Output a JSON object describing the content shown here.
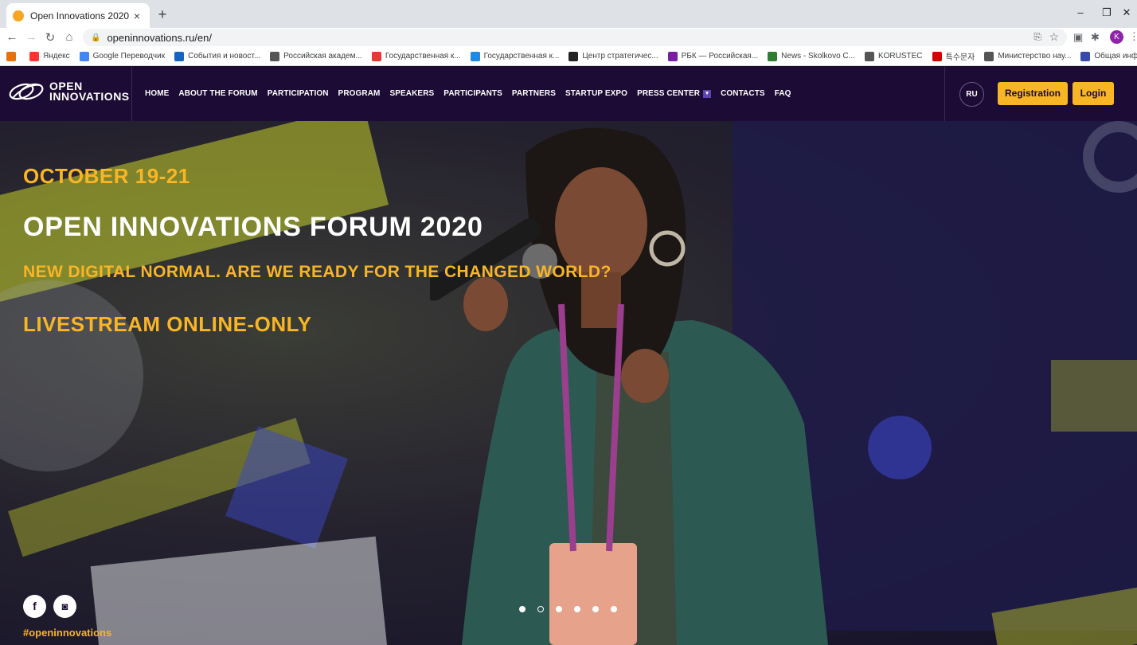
{
  "browser": {
    "tab_title": "Open Innovations 2020",
    "tab_close": "×",
    "new_tab": "+",
    "url": "openinnovations.ru/en/",
    "window_minimize": "–",
    "window_restore": "❐",
    "window_close": "✕",
    "avatar_letter": "K",
    "bookmarks": [
      {
        "label": "Яндекс",
        "color": "#ff3333"
      },
      {
        "label": "Google Переводчик",
        "color": "#4285f4"
      },
      {
        "label": "События и новост...",
        "color": "#1565c0"
      },
      {
        "label": "Российская академ...",
        "color": "#555555"
      },
      {
        "label": "Государственная к...",
        "color": "#e53935"
      },
      {
        "label": "Государственная к...",
        "color": "#1e88e5"
      },
      {
        "label": "Центр стратегичес...",
        "color": "#222222"
      },
      {
        "label": "РБК — Российская...",
        "color": "#7b1fa2"
      },
      {
        "label": "News - Skolkovo C...",
        "color": "#2e7d32"
      },
      {
        "label": "KORUSTEC",
        "color": "#555555"
      },
      {
        "label": "특수문자",
        "color": "#d50000"
      },
      {
        "label": "Министерство нау...",
        "color": "#555555"
      },
      {
        "label": "Общая информац...",
        "color": "#3949ab"
      }
    ]
  },
  "header": {
    "logo_line1": "OPEN",
    "logo_line2": "INNOVATIONS",
    "nav": [
      "HOME",
      "ABOUT THE FORUM",
      "PARTICIPATION",
      "PROGRAM",
      "SPEAKERS",
      "PARTICIPANTS",
      "PARTNERS",
      "STARTUP EXPO",
      "PRESS CENTER",
      "CONTACTS",
      "FAQ"
    ],
    "lang": "RU",
    "registration": "Registration",
    "login": "Login"
  },
  "hero": {
    "date": "OCTOBER 19-21",
    "title": "OPEN INNOVATIONS FORUM 2020",
    "subtitle": "NEW DIGITAL NORMAL. ARE WE READY FOR THE CHANGED WORLD?",
    "live": "LIVESTREAM ONLINE-ONLY",
    "hashtag": "#openinnovations",
    "social_facebook": "f",
    "social_instagram": "◙",
    "slides": 6,
    "active_slide": 2
  },
  "colors": {
    "accent": "#f8b526",
    "header_bg": "#1c0b34"
  }
}
